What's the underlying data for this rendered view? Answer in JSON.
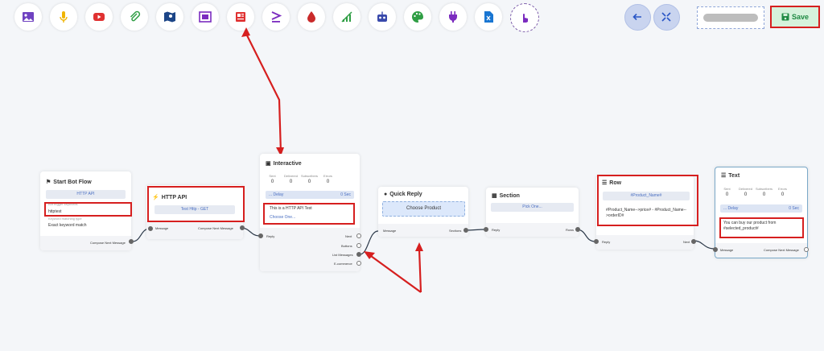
{
  "toolbar": {
    "icons": [
      "image-icon",
      "microphone-icon",
      "video-icon",
      "attachment-icon",
      "map-icon",
      "carousel-icon",
      "news-icon",
      "condition-icon",
      "blood-drop-icon",
      "chart-icon",
      "robot-icon",
      "palette-icon",
      "plug-icon",
      "excel-icon",
      "pointer-icon"
    ],
    "colors": {
      "image": "#6f42c1",
      "mic": "#f0b400",
      "video": "#e03131",
      "attach": "#2f9e44",
      "map": "#1c4587",
      "carousel": "#7b2cbf",
      "news": "#e03131",
      "cond": "#7b2cbf",
      "drop": "#c92a2a",
      "chart": "#2f9e44",
      "robot": "#3949ab",
      "palette": "#2f9e44",
      "plug": "#7b2cbf",
      "excel": "#1976d2",
      "pointer": "#7b2cbf"
    },
    "nav_icons": [
      "arrow-left-icon",
      "collapse-icon"
    ],
    "save_label": "Save"
  },
  "nodes": {
    "start": {
      "title": "Start Bot Flow",
      "api_button": "HTTP API",
      "keywords_label": "Bot trigger keywords",
      "keyword_value": "httptest",
      "match_label": "Keyword matching type",
      "match_value": "Exact keyword match",
      "footer": "Compose Next Message"
    },
    "http_api": {
      "title": "HTTP API",
      "test_button": "Test Http - GET",
      "port_in": "Message",
      "port_out": "Compose Next Message"
    },
    "interactive": {
      "title": "Interactive",
      "stats": [
        {
          "label": "Sent",
          "value": "0"
        },
        {
          "label": "Delivered",
          "value": "0"
        },
        {
          "label": "Subscribers",
          "value": "0"
        },
        {
          "label": "Errors",
          "value": "0"
        }
      ],
      "delay_label": "... Delay",
      "delay_value": "0 Sec",
      "message": "This is a HTTP API Test",
      "choose": "Choose One...",
      "port_in": "Reply",
      "outputs": [
        "Next",
        "Buttons",
        "List Messages",
        "E-commerce"
      ]
    },
    "quick_reply": {
      "title": "Quick Reply",
      "button": "Choose Product",
      "port_in": "Message",
      "port_out": "Sections"
    },
    "section": {
      "title": "Section",
      "pick": "Pick One...",
      "port_in": "Reply",
      "port_out": "Rows"
    },
    "row": {
      "title": "Row",
      "name_bar": "#Product_Name#",
      "desc": "#Product_Name-->price# - #Product_Name-->orderID#",
      "port_in": "Reply",
      "port_out": "Next"
    },
    "text": {
      "title": "Text",
      "stats": [
        {
          "label": "Sent",
          "value": "0"
        },
        {
          "label": "Delivered",
          "value": "0"
        },
        {
          "label": "Subscribers",
          "value": "0"
        },
        {
          "label": "Errors",
          "value": "0"
        }
      ],
      "delay_label": "... Delay",
      "delay_value": "0 Sec",
      "message": "You can buy our product from #selected_product#",
      "port_in": "Message",
      "port_out": "Compose Next Message"
    }
  }
}
